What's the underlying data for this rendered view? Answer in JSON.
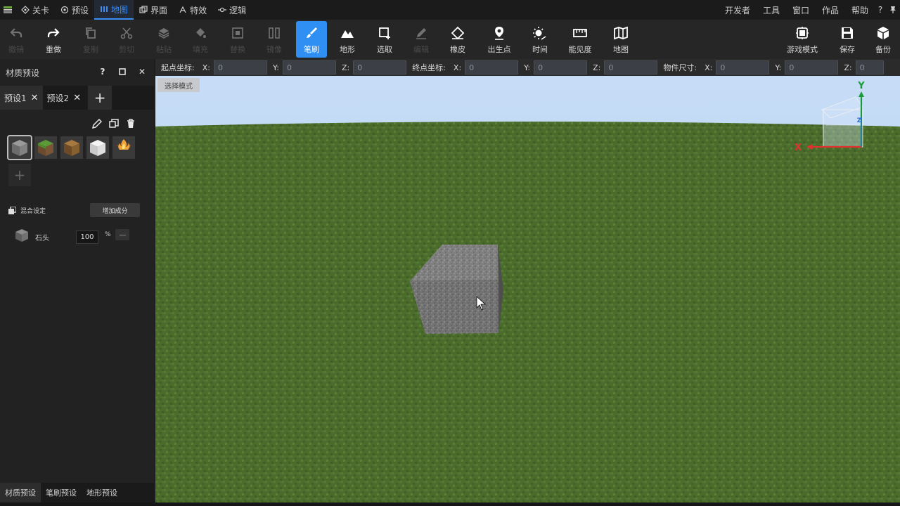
{
  "menubar": {
    "tabs": [
      {
        "label": "关卡",
        "icon": "level-icon"
      },
      {
        "label": "预设",
        "icon": "preset-icon"
      },
      {
        "label": "地图",
        "icon": "map-bars-icon",
        "active": true
      },
      {
        "label": "界面",
        "icon": "ui-icon"
      },
      {
        "label": "特效",
        "icon": "effects-icon"
      },
      {
        "label": "逻辑",
        "icon": "logic-icon"
      }
    ],
    "right_items": [
      "开发者",
      "工具",
      "窗口",
      "作品",
      "帮助"
    ],
    "help_symbol": "?"
  },
  "toolbar": {
    "undo": "撤销",
    "redo": "重做",
    "copy": "复制",
    "cut": "剪切",
    "paste": "粘贴",
    "fill": "填充",
    "replace": "替换",
    "mirror": "镜像",
    "brush": "笔刷",
    "terrain": "地形",
    "select": "选取",
    "pencil": "编辑",
    "eraser": "橡皮",
    "spawn": "出生点",
    "time": "时间",
    "visibility": "能见度",
    "map": "地图",
    "game_mode": "游戏模式",
    "save": "保存",
    "backup": "备份"
  },
  "left_panel": {
    "title": "材质预设",
    "header_buttons": {
      "help": "?",
      "close": "✕"
    },
    "tabs": [
      {
        "label": "预设1",
        "active": true
      },
      {
        "label": "预设2",
        "active": false
      }
    ],
    "add_tab": "+",
    "swatches": [
      "stone",
      "grass",
      "dirt",
      "snow",
      "fire"
    ],
    "add_swatch": "+",
    "mix_label": "混合设定",
    "add_component": "增加成分",
    "component": {
      "name": "石头",
      "percent": "100",
      "unit": "%"
    },
    "bottom_tabs": [
      "材质预设",
      "笔刷预设",
      "地形预设"
    ]
  },
  "coordbar": {
    "start_label": "起点坐标:",
    "end_label": "终点坐标:",
    "size_label": "物件尺寸:",
    "axis_x": "X:",
    "axis_y": "Y:",
    "axis_z": "Z:",
    "start": {
      "x": "0",
      "y": "0",
      "z": "0"
    },
    "end": {
      "x": "0",
      "y": "0",
      "z": "0"
    },
    "size": {
      "x": "0",
      "y": "0",
      "z": "0"
    }
  },
  "viewport": {
    "mode_button": "选择模式",
    "gizmo": {
      "y": "Y",
      "x": "X",
      "z": "Z"
    },
    "colors": {
      "sky": "#bcd7f5",
      "grass": "#4a6b2c",
      "stone": "#7d7d7d",
      "accent": "#2f8ff3"
    }
  }
}
